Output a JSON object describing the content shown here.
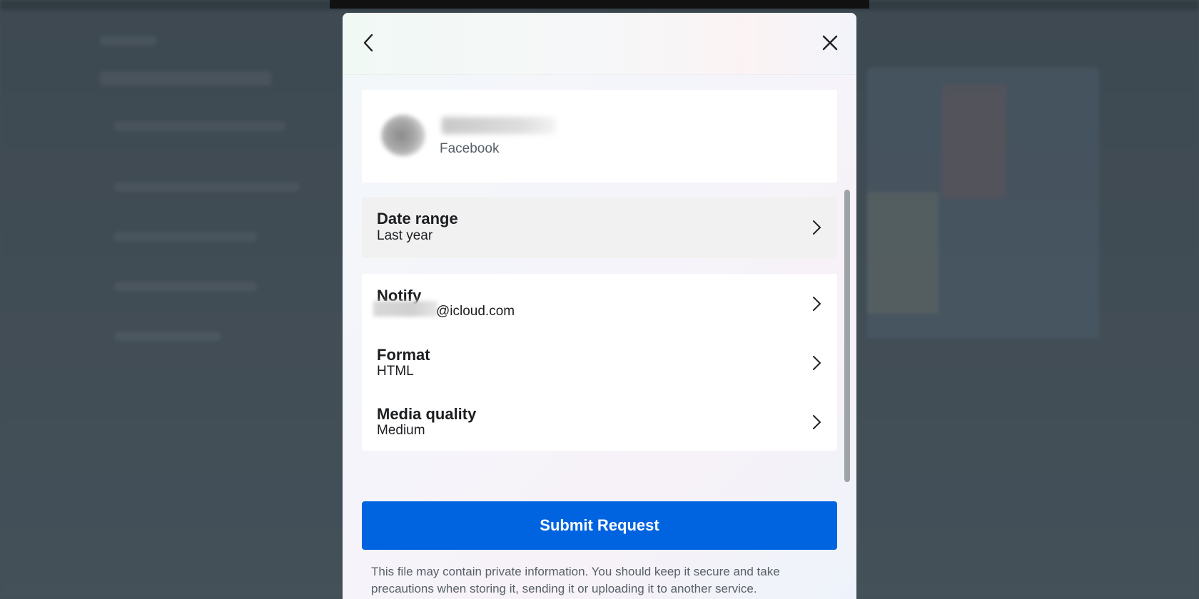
{
  "dialog": {
    "back_icon": "chevron-left-icon",
    "close_icon": "close-icon"
  },
  "profile": {
    "platform": "Facebook"
  },
  "settings": {
    "date_range": {
      "label": "Date range",
      "value": "Last year"
    },
    "notify": {
      "label": "Notify",
      "value": "@icloud.com"
    },
    "format": {
      "label": "Format",
      "value": "HTML"
    },
    "media_quality": {
      "label": "Media quality",
      "value": "Medium"
    }
  },
  "submit_label": "Submit Request",
  "disclaimer": "This file may contain private information. You should keep it secure and take precautions when storing it, sending it or uploading it to another service.",
  "colors": {
    "accent": "#0064e0",
    "text_primary": "#1c1e21",
    "text_secondary": "#57606a"
  }
}
